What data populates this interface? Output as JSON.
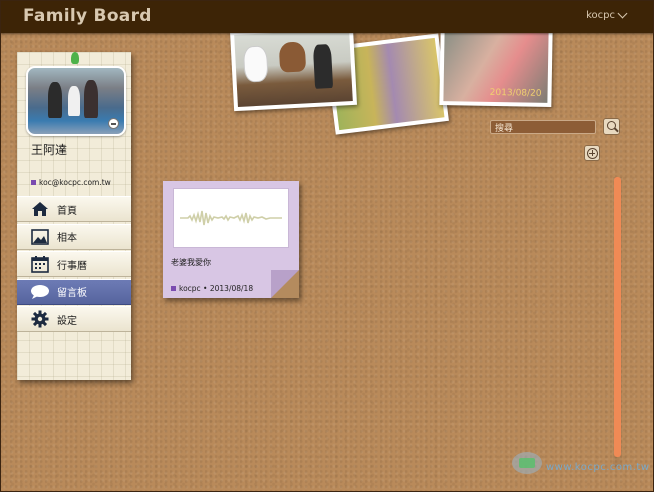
{
  "app": {
    "title": "Family Board",
    "user_menu": "kocpc"
  },
  "photos": [
    {
      "date": ""
    },
    {
      "date": ""
    },
    {
      "date": "2013/08/20"
    }
  ],
  "search": {
    "value": "搜尋"
  },
  "profile": {
    "name": "王阿達",
    "email": "koc@kocpc.com.tw"
  },
  "nav": [
    {
      "label": "首頁",
      "icon": "home-icon",
      "active": false
    },
    {
      "label": "相本",
      "icon": "photo-album-icon",
      "active": false
    },
    {
      "label": "行事曆",
      "icon": "calendar-icon",
      "active": false
    },
    {
      "label": "留言板",
      "icon": "speech-bubble-icon",
      "active": true
    },
    {
      "label": "設定",
      "icon": "gear-icon",
      "active": false
    }
  ],
  "note": {
    "text": "老婆我愛你",
    "meta": "kocpc • 2013/08/18",
    "media": "audio-waveform"
  },
  "colors": {
    "topbar": "#3d2406",
    "cork": "#b98a5a",
    "note": "#d8c6e4",
    "active_nav": "#5f6ca8",
    "scrollbar": "#f08a55",
    "tag": "#7a4bb0"
  },
  "watermark": {
    "text": "www.kocpc.com.tw"
  }
}
